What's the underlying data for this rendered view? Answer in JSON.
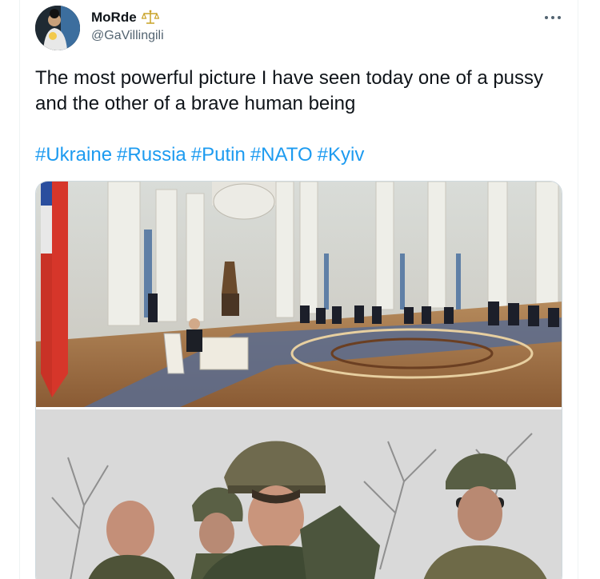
{
  "author": {
    "display_name": "MoRde",
    "handle": "@GaVillingili",
    "badge_icon": "scales-icon",
    "avatar_icon": "profile-photo"
  },
  "tweet": {
    "text": "The most powerful picture I have seen today one of a pussy and the other of a brave human being",
    "hashtags": [
      "#Ukraine",
      "#Russia",
      "#Putin",
      "#NATO",
      "#Kyiv"
    ]
  },
  "menu": {
    "icon": "more-options-icon"
  },
  "media": {
    "photos": [
      "kremlin-hall-photo",
      "soldiers-photo"
    ]
  },
  "colors": {
    "link": "#1d9bf0",
    "text": "#0f1419",
    "secondary": "#536471",
    "border": "#cfd9de"
  }
}
